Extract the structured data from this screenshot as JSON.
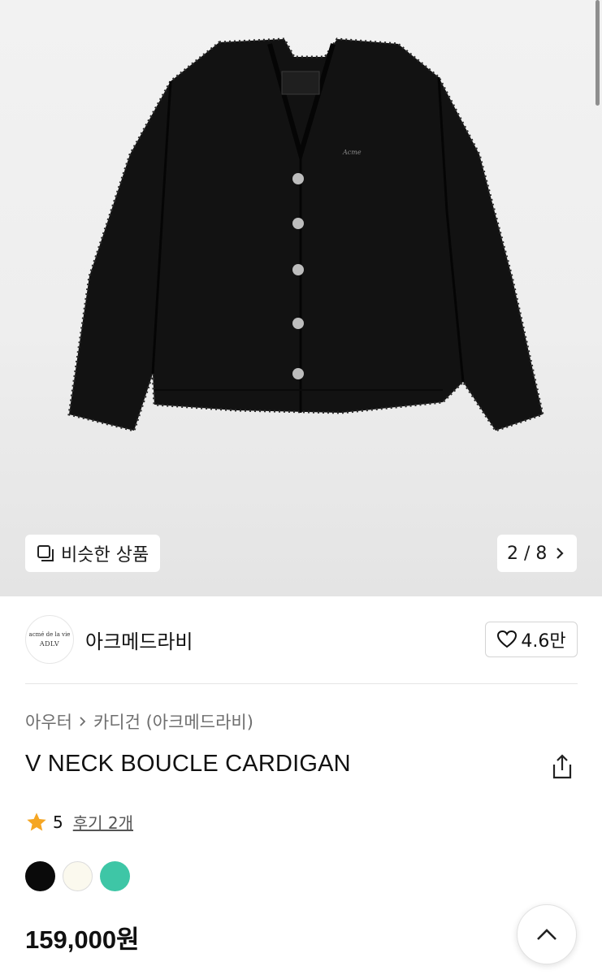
{
  "gallery": {
    "similar_label": "비슷한 상품",
    "pager": "2 / 8",
    "garment_tag_text": "acmé de la vie ADLV"
  },
  "brand": {
    "logo_line1": "acmé de la vie",
    "logo_line2": "ADLV",
    "name": "아크메드라비",
    "likes": "4.6만"
  },
  "breadcrumb": {
    "category": "아우터",
    "subcategory": "카디건 (아크메드라비)"
  },
  "product": {
    "title": "V NECK BOUCLE CARDIGAN",
    "rating": "5",
    "review_link": "후기 2개",
    "price": "159,000원"
  },
  "colors": {
    "options": [
      "#0a0a0a",
      "#fbf9ee",
      "#3ec6a6"
    ],
    "star": "#f5a623"
  }
}
